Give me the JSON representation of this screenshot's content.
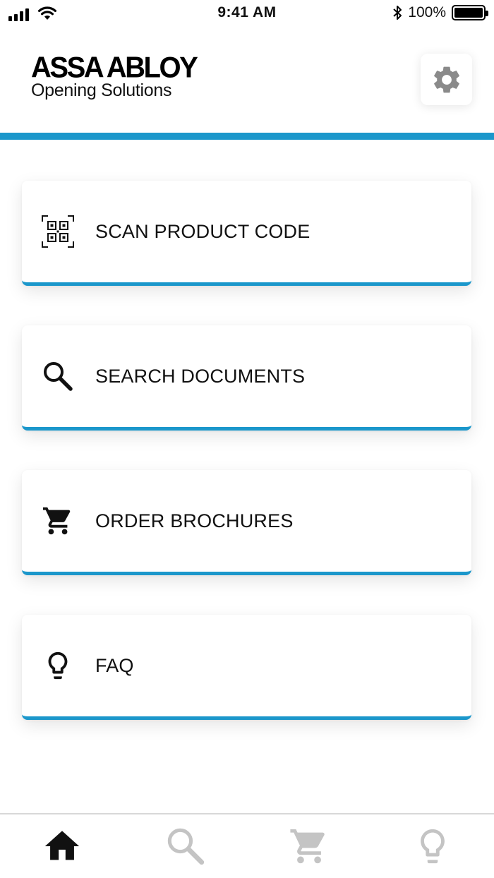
{
  "status_bar": {
    "time": "9:41 AM",
    "battery_text": "100%",
    "battery_level": 1.0,
    "icons": [
      "signal-icon",
      "wifi-icon",
      "bluetooth-icon",
      "battery-icon"
    ]
  },
  "header": {
    "brand": "ASSA ABLOY",
    "subtitle": "Opening Solutions",
    "settings_icon": "gear-icon"
  },
  "menu": {
    "items": [
      {
        "label": "SCAN PRODUCT CODE",
        "icon": "qr-code-icon"
      },
      {
        "label": "SEARCH DOCUMENTS",
        "icon": "search-icon"
      },
      {
        "label": "ORDER BROCHURES",
        "icon": "cart-icon"
      },
      {
        "label": "FAQ",
        "icon": "lightbulb-icon"
      }
    ]
  },
  "tab_bar": {
    "tabs": [
      {
        "icon": "home-icon",
        "active": true
      },
      {
        "icon": "search-icon",
        "active": false
      },
      {
        "icon": "cart-icon",
        "active": false
      },
      {
        "icon": "lightbulb-icon",
        "active": false
      }
    ]
  },
  "colors": {
    "accent": "#1b97cb",
    "inactive_tab": "#c4c4c4",
    "gear": "#8a8a8a",
    "text": "#111111"
  }
}
